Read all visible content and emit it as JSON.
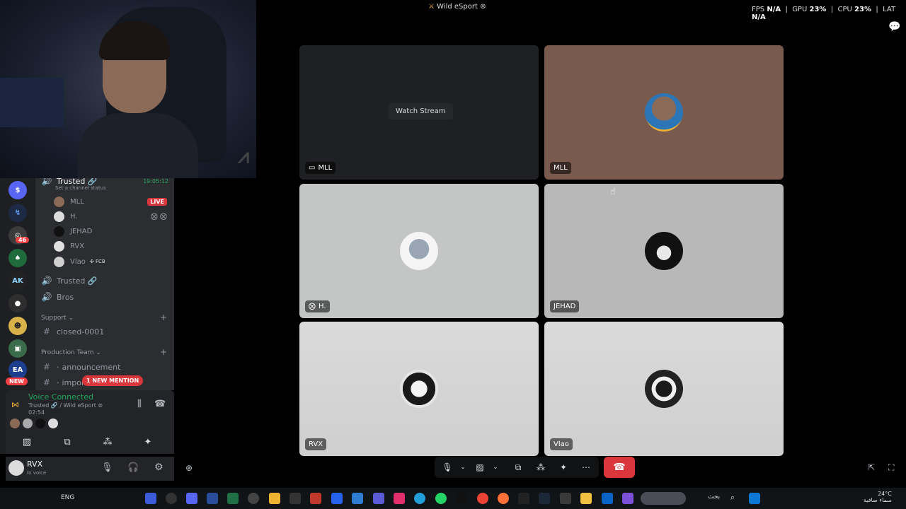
{
  "window": {
    "title": "Wild eSport ⊚"
  },
  "performance": {
    "fps_label": "FPS",
    "fps_value": "N/A",
    "gpu_label": "GPU",
    "gpu_value": "23%",
    "cpu_label": "CPU",
    "cpu_value": "23%",
    "lat_label": "LAT",
    "lat_value": "N/A"
  },
  "server_rail": {
    "badge_count": "46",
    "new_label": "NEW"
  },
  "channels": {
    "active_voice": {
      "name": "Trusted 🔗",
      "status": "Set a channel status",
      "time": "19:05:12"
    },
    "members": [
      {
        "name": "MLL",
        "live": "LIVE"
      },
      {
        "name": "H."
      },
      {
        "name": "JEHAD"
      },
      {
        "name": "RVX"
      },
      {
        "name": "Vlao",
        "tag": "FCB"
      }
    ],
    "voice_channels": [
      {
        "name": "Trusted 🔗"
      },
      {
        "name": "Bros"
      }
    ],
    "categories": [
      {
        "name": "Support",
        "channels": [
          "closed-0001"
        ]
      },
      {
        "name": "Production Team",
        "channels": [
          "announcement",
          "impor"
        ]
      }
    ],
    "mention_pill": "1 NEW MENTION"
  },
  "voice_panel": {
    "status": "Voice Connected",
    "location": "Trusted 🔗 / Wild eSport ⊚",
    "elapsed": "02:54"
  },
  "user_bar": {
    "name": "RVX",
    "status": "In voice"
  },
  "grid": {
    "tiles": [
      {
        "label": "MLL",
        "kind": "stream",
        "button": "Watch Stream"
      },
      {
        "label": "MLL",
        "kind": "avatar",
        "bg": "#7b5a4e"
      },
      {
        "label": "H.",
        "kind": "avatar",
        "bg": "#c4c6c6"
      },
      {
        "label": "JEHAD",
        "kind": "avatar",
        "bg": "#b8b8b8"
      },
      {
        "label": "RVX",
        "kind": "avatar",
        "bg": "#d2d2d2"
      },
      {
        "label": "Vlao",
        "kind": "avatar",
        "bg": "#d0d0d0"
      }
    ]
  },
  "taskbar": {
    "lang": "ENG",
    "search": "بحث",
    "weather_temp": "24°C",
    "weather_desc": "سماء صافية"
  },
  "colors": {
    "accent_green": "#23a55a",
    "danger_red": "#da373c",
    "sidebar_bg": "#2b2d31",
    "rail_bg": "#1e1f22"
  }
}
